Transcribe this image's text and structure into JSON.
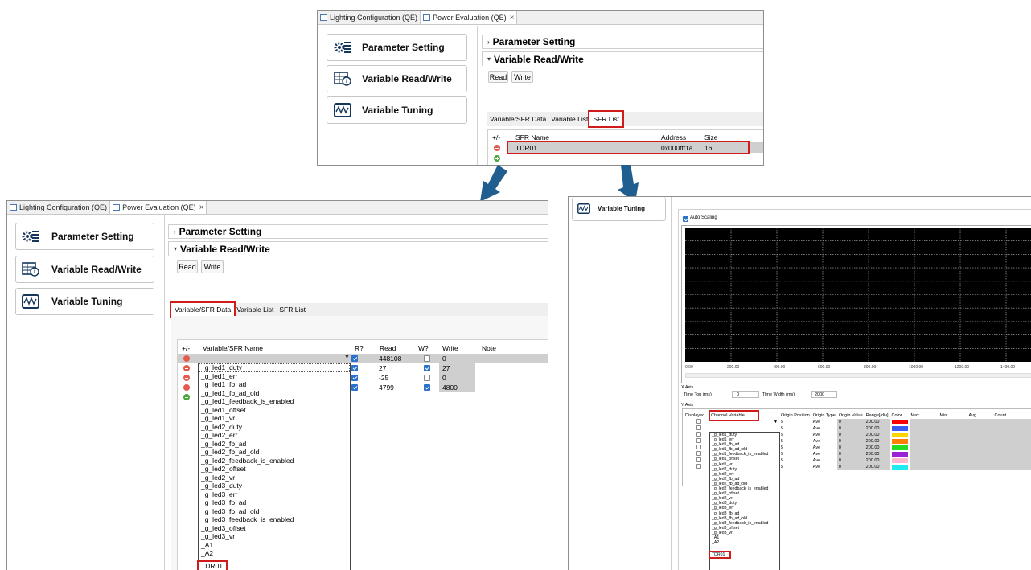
{
  "colors": {
    "highlight": "#d11a1a",
    "arrow": "#1f5e8e",
    "plot_bg": "#000000"
  },
  "top_panel": {
    "tabs": [
      "Lighting Configuration (QE)",
      "Power Evaluation (QE)"
    ],
    "tab_close": "×",
    "nav": [
      {
        "label": "Parameter Setting",
        "icon": "gear-grid-icon"
      },
      {
        "label": "Variable Read/Write",
        "icon": "table-readwrite-icon"
      },
      {
        "label": "Variable Tuning",
        "icon": "waveform-icon"
      }
    ],
    "sections": {
      "parameter_setting": "Parameter Setting",
      "variable_rw": "Variable Read/Write"
    },
    "buttons": {
      "read": "Read",
      "write": "Write"
    },
    "subtabs": [
      "Variable/SFR Data",
      "Variable List",
      "SFR List"
    ],
    "table": {
      "headers": [
        "+/-",
        "SFR Name",
        "Address",
        "Size"
      ],
      "rows": [
        {
          "name": "TDR01",
          "address": "0x000fff1a",
          "size": "16"
        }
      ]
    }
  },
  "left_panel": {
    "tabs": [
      "Lighting Configuration (QE)",
      "Power Evaluation (QE)"
    ],
    "tab_close": "×",
    "nav": [
      {
        "label": "Parameter Setting"
      },
      {
        "label": "Variable Read/Write"
      },
      {
        "label": "Variable Tuning"
      }
    ],
    "sections": {
      "parameter_setting": "Parameter Setting",
      "variable_rw": "Variable Read/Write"
    },
    "buttons": {
      "read": "Read",
      "write": "Write"
    },
    "subtabs": [
      "Variable/SFR Data",
      "Variable List",
      "SFR List"
    ],
    "table": {
      "headers": [
        "+/-",
        "Variable/SFR Name",
        "R?",
        "Read",
        "W?",
        "Write",
        "Note"
      ],
      "rows": [
        {
          "read": "448108",
          "r_checked": true,
          "w_checked": false,
          "write": "0"
        },
        {
          "read": "27",
          "r_checked": true,
          "w_checked": true,
          "write": "27"
        },
        {
          "read": "-25",
          "r_checked": true,
          "w_checked": false,
          "write": "0"
        },
        {
          "read": "4799",
          "r_checked": true,
          "w_checked": true,
          "write": "4800"
        }
      ]
    },
    "dropdown": [
      "_g_led1_duty",
      "_g_led1_err",
      "_g_led1_fb_ad",
      "_g_led1_fb_ad_old",
      "_g_led1_feedback_is_enabled",
      "_g_led1_offset",
      "_g_led1_vr",
      "_g_led2_duty",
      "_g_led2_err",
      "_g_led2_fb_ad",
      "_g_led2_fb_ad_old",
      "_g_led2_feedback_is_enabled",
      "_g_led2_offset",
      "_g_led2_vr",
      "_g_led3_duty",
      "_g_led3_err",
      "_g_led3_fb_ad",
      "_g_led3_fb_ad_old",
      "_g_led3_feedback_is_enabled",
      "_g_led3_offset",
      "_g_led3_vr",
      "_A1",
      "_A2",
      "TDR01"
    ]
  },
  "right_panel": {
    "nav_label": "Variable Tuning",
    "auto_scaling": "Auto Scaling",
    "x_ticks": [
      "0.00",
      "200.00",
      "400.00",
      "600.00",
      "800.00",
      "1000.00",
      "1200.00",
      "1400.00"
    ],
    "x_axis": {
      "title": "X Axis",
      "time_top_label": "Time Top (ms)",
      "time_top_value": "0",
      "time_width_label": "Time Width (ms)",
      "time_width_value": "2000"
    },
    "y_axis_title": "Y Axis",
    "y_headers": [
      "Displayed",
      "Channel Variable",
      "Origin Position",
      "Origin Type",
      "Origin Value",
      "Range[/div]",
      "Color",
      "Max",
      "Min",
      "Avg",
      "Count"
    ],
    "y_rows": [
      {
        "pos": "5",
        "type": "Ave",
        "value": "0",
        "range": "200.00",
        "color": "#ff0000"
      },
      {
        "pos": "5",
        "type": "Ave",
        "value": "0",
        "range": "200.00",
        "color": "#3a5cf0"
      },
      {
        "pos": "5",
        "type": "Ave",
        "value": "0",
        "range": "200.00",
        "color": "#ffd400"
      },
      {
        "pos": "5",
        "type": "Ave",
        "value": "0",
        "range": "200.00",
        "color": "#ff7f00"
      },
      {
        "pos": "5",
        "type": "Ave",
        "value": "0",
        "range": "200.00",
        "color": "#22dd22"
      },
      {
        "pos": "5",
        "type": "Ave",
        "value": "0",
        "range": "200.00",
        "color": "#9a22d6"
      },
      {
        "pos": "5",
        "type": "Ave",
        "value": "0",
        "range": "200.00",
        "color": "#ffb6d0"
      },
      {
        "pos": "5",
        "type": "Ave",
        "value": "0",
        "range": "200.00",
        "color": "#22e8f0"
      }
    ],
    "dropdown": [
      "_g_led1_duty",
      "_g_led1_err",
      "_g_led1_fb_ad",
      "_g_led1_fb_ad_old",
      "_g_led1_feedback_is_enabled",
      "_g_led1_offset",
      "_g_led1_vr",
      "_g_led2_duty",
      "_g_led2_err",
      "_g_led2_fb_ad",
      "_g_led2_fb_ad_old",
      "_g_led2_feedback_is_enabled",
      "_g_led2_offset",
      "_g_led2_vr",
      "_g_led3_duty",
      "_g_led3_err",
      "_g_led3_fb_ad",
      "_g_led3_fb_ad_old",
      "_g_led3_feedback_is_enabled",
      "_g_led3_offset",
      "_g_led3_vr",
      "_A1",
      "_A2",
      "TDR01"
    ]
  }
}
